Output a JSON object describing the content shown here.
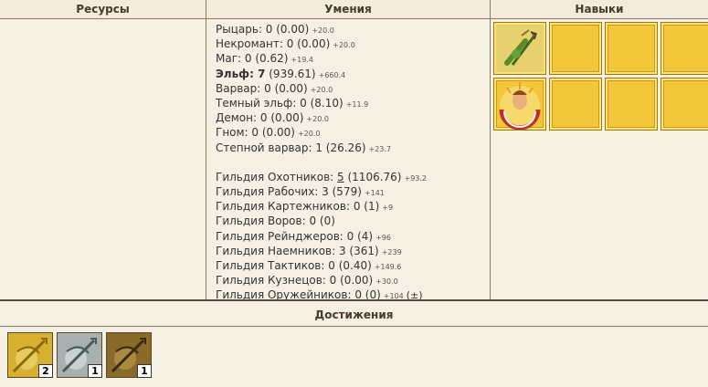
{
  "headers": {
    "resources": "Ресурсы",
    "skills": "Умения",
    "talents": "Навыки"
  },
  "factions": [
    {
      "name": "Рыцарь:",
      "level": "0",
      "points": "(0.00)",
      "next": "+20.0",
      "bold": false
    },
    {
      "name": "Некромант:",
      "level": "0",
      "points": "(0.00)",
      "next": "+20.0",
      "bold": false
    },
    {
      "name": "Маг:",
      "level": "0",
      "points": "(0.62)",
      "next": "+19.4",
      "bold": false
    },
    {
      "name": "Эльф:",
      "level": "7",
      "points": "(939.61)",
      "next": "+660.4",
      "bold": true
    },
    {
      "name": "Варвар:",
      "level": "0",
      "points": "(0.00)",
      "next": "+20.0",
      "bold": false
    },
    {
      "name": "Темный эльф:",
      "level": "0",
      "points": "(8.10)",
      "next": "+11.9",
      "bold": false
    },
    {
      "name": "Демон:",
      "level": "0",
      "points": "(0.00)",
      "next": "+20.0",
      "bold": false
    },
    {
      "name": "Гном:",
      "level": "0",
      "points": "(0.00)",
      "next": "+20.0",
      "bold": false
    },
    {
      "name": "Степной варвар:",
      "level": "1",
      "points": "(26.26)",
      "next": "+23.7",
      "bold": false
    }
  ],
  "guilds": [
    {
      "name": "Гильдия Охотников:",
      "level": "5",
      "points": "(1106.76)",
      "next": "+93.2",
      "link": true
    },
    {
      "name": "Гильдия Рабочих:",
      "level": "3",
      "points": "(579)",
      "next": "+141",
      "link": false
    },
    {
      "name": "Гильдия Картежников:",
      "level": "0",
      "points": "(1)",
      "next": "+9",
      "link": false
    },
    {
      "name": "Гильдия Воров:",
      "level": "0",
      "points": "(0)",
      "next": "",
      "link": false
    },
    {
      "name": "Гильдия Рейнджеров:",
      "level": "0",
      "points": "(4)",
      "next": "+96",
      "link": false
    },
    {
      "name": "Гильдия Наемников:",
      "level": "3",
      "points": "(361)",
      "next": "+239",
      "link": false
    },
    {
      "name": "Гильдия Тактиков:",
      "level": "0",
      "points": "(0.40)",
      "next": "+149.6",
      "link": false
    },
    {
      "name": "Гильдия Кузнецов:",
      "level": "0",
      "points": "(0.00)",
      "next": "+30.0",
      "link": false
    },
    {
      "name": "Гильдия Оружейников:",
      "level": "0",
      "points": "(0)",
      "next": "+104",
      "link": false,
      "extra": "(±)"
    }
  ],
  "talent_icons": [
    "elf-archer-icon",
    "",
    "",
    "",
    "sun-portrait-icon",
    "",
    "",
    ""
  ],
  "achievements_title": "Достижения",
  "achievements": [
    {
      "icon": "golden-archer-icon",
      "count": "2"
    },
    {
      "icon": "silver-archer-icon",
      "count": "1"
    },
    {
      "icon": "bronze-archer-icon",
      "count": "1"
    }
  ],
  "colors": {
    "background": "#f6f0e4",
    "tile": "#f2c83a",
    "border": "#8a7a64"
  }
}
